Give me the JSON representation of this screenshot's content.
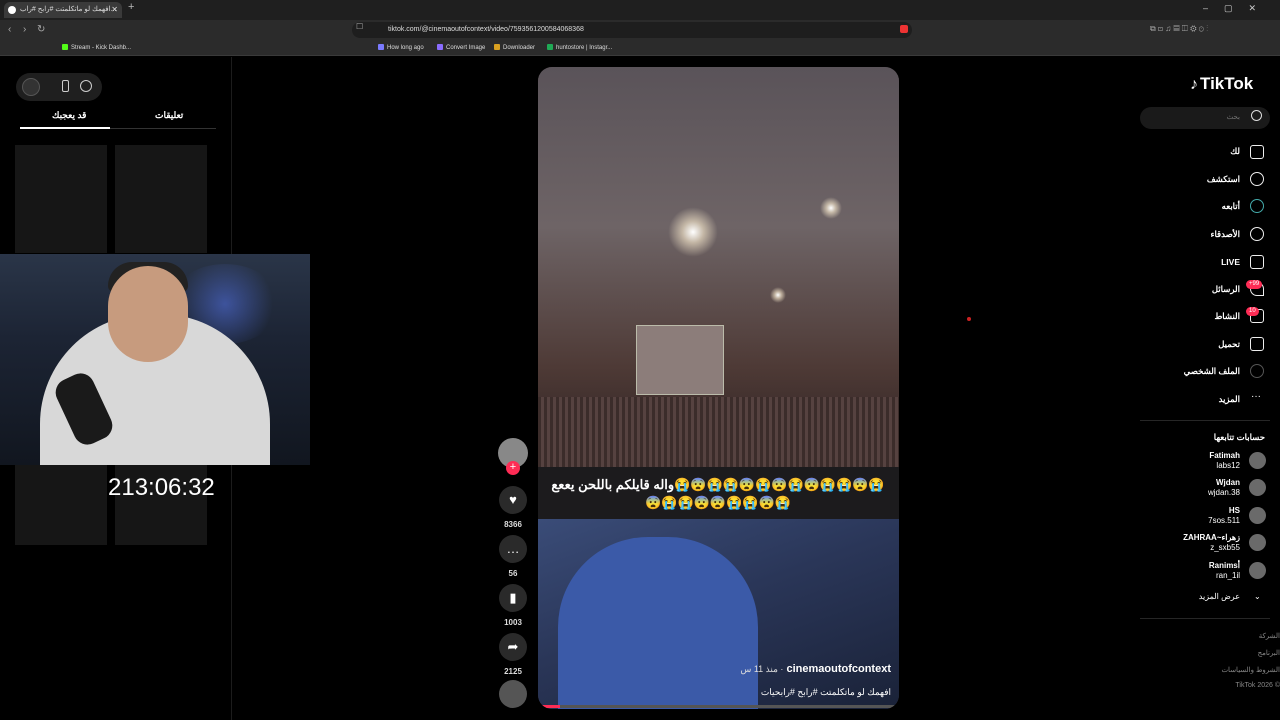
{
  "browser": {
    "tab_title": "افهمك لو ماتكلمتت #رابح #راب...",
    "url": "tiktok.com/@cinemaoutofcontext/video/7593561200584068368",
    "bookmarks": [
      "Stream - Kick Dashb...",
      "How long ago",
      "Convert Image",
      "Downloader",
      "huntostore | Instagr..."
    ]
  },
  "left_panel": {
    "tab_comments": "تعليقات",
    "tab_liked": "قد يعجبك",
    "timer": "213:06:32"
  },
  "video": {
    "caption": "واله قايلكم  باللحن يععع😭😨😭😭😨😭😨😭😨😭😭😨😭😨😭😭😨😨😭😭😨😭",
    "author": "cinemaoutofcontext",
    "time_ago": "منذ 11 س",
    "description": "افهمك لو ماتكلمتت #رابح #رابحيات",
    "progress": 0.06
  },
  "actions": {
    "likes": "8366",
    "comments": "56",
    "saves": "1003",
    "shares": "2125"
  },
  "sidebar": {
    "logo": "TikTok",
    "search_placeholder": "بحث",
    "nav": [
      {
        "label": "لك"
      },
      {
        "label": "استكشف"
      },
      {
        "label": "أتابعه"
      },
      {
        "label": "الأصدقاء"
      },
      {
        "label": "LIVE"
      },
      {
        "label": "الرسائل",
        "badge": "+99"
      },
      {
        "label": "النشاط",
        "badge": "10"
      },
      {
        "label": "تحميل"
      },
      {
        "label": "الملف الشخصي"
      },
      {
        "label": "المزيد"
      }
    ],
    "following_title": "حسابات تتابعها",
    "following": [
      {
        "name": "Fatimah",
        "user": "labs12"
      },
      {
        "name": "Wjdan",
        "user": "wjdan.38"
      },
      {
        "name": "HS",
        "user": "7sos.511"
      },
      {
        "name": "ZAHRAA~زهراء",
        "user": "z_sxb55"
      },
      {
        "name": "Ranimsأ",
        "user": "ran_1il"
      }
    ],
    "show_more": "عرض المزيد",
    "footer": [
      "الشركة",
      "البرنامج",
      "الشروط والسياسات",
      "© 2026 TikTok"
    ]
  },
  "colors": {
    "accent": "#fe2c55",
    "bg": "#000000"
  }
}
